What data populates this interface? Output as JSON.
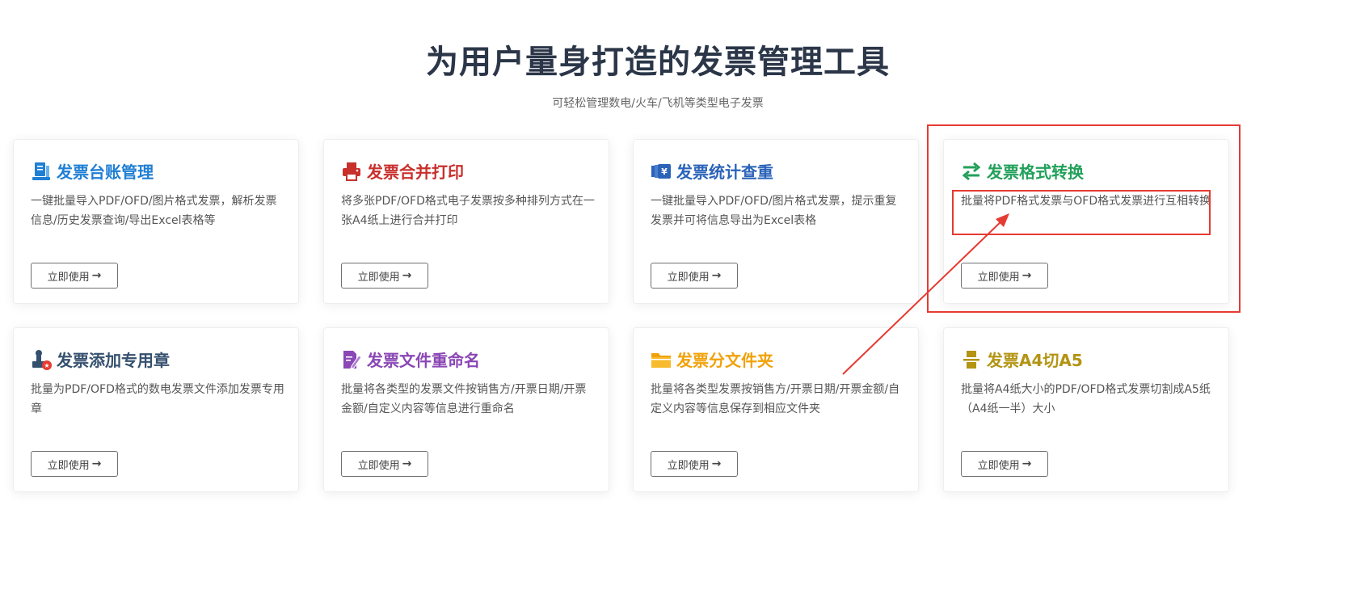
{
  "header": {
    "title": "为用户量身打造的发票管理工具",
    "subtitle": "可轻松管理数电/火车/飞机等类型电子发票"
  },
  "colors": {
    "title_dark": "#2b3648",
    "blue": "#1f7fd4",
    "red": "#c8302c",
    "navy": "#2b63b8",
    "green": "#22a05a",
    "slate": "#35506e",
    "purple": "#8a47b5",
    "orange": "#f0a20a",
    "olive": "#b39413",
    "annotation": "#e63a32"
  },
  "cards": [
    {
      "icon": "ledger-icon",
      "title": "发票台账管理",
      "desc": "一键批量导入PDF/OFD/图片格式发票，解析发票信息/历史发票查询/导出Excel表格等",
      "button": "立即使用"
    },
    {
      "icon": "printer-icon",
      "title": "发票合并打印",
      "desc": "将多张PDF/OFD格式电子发票按多种排列方式在一张A4纸上进行合并打印",
      "button": "立即使用"
    },
    {
      "icon": "yen-stack-icon",
      "title": "发票统计查重",
      "desc": "一键批量导入PDF/OFD/图片格式发票，提示重复发票并可将信息导出为Excel表格",
      "button": "立即使用"
    },
    {
      "icon": "swap-arrows-icon",
      "title": "发票格式转换",
      "desc": "批量将PDF格式发票与OFD格式发票进行互相转换",
      "button": "立即使用"
    },
    {
      "icon": "stamp-icon",
      "title": "发票添加专用章",
      "desc": "批量为PDF/OFD格式的数电发票文件添加发票专用章",
      "button": "立即使用"
    },
    {
      "icon": "edit-file-icon",
      "title": "发票文件重命名",
      "desc": "批量将各类型的发票文件按销售方/开票日期/开票金额/自定义内容等信息进行重命名",
      "button": "立即使用"
    },
    {
      "icon": "folder-icon",
      "title": "发票分文件夹",
      "desc": "批量将各类型发票按销售方/开票日期/开票金额/自定义内容等信息保存到相应文件夹",
      "button": "立即使用"
    },
    {
      "icon": "cut-page-icon",
      "title": "发票A4切A5",
      "desc": "批量将A4纸大小的PDF/OFD格式发票切割成A5纸（A4纸一半）大小",
      "button": "立即使用"
    }
  ]
}
